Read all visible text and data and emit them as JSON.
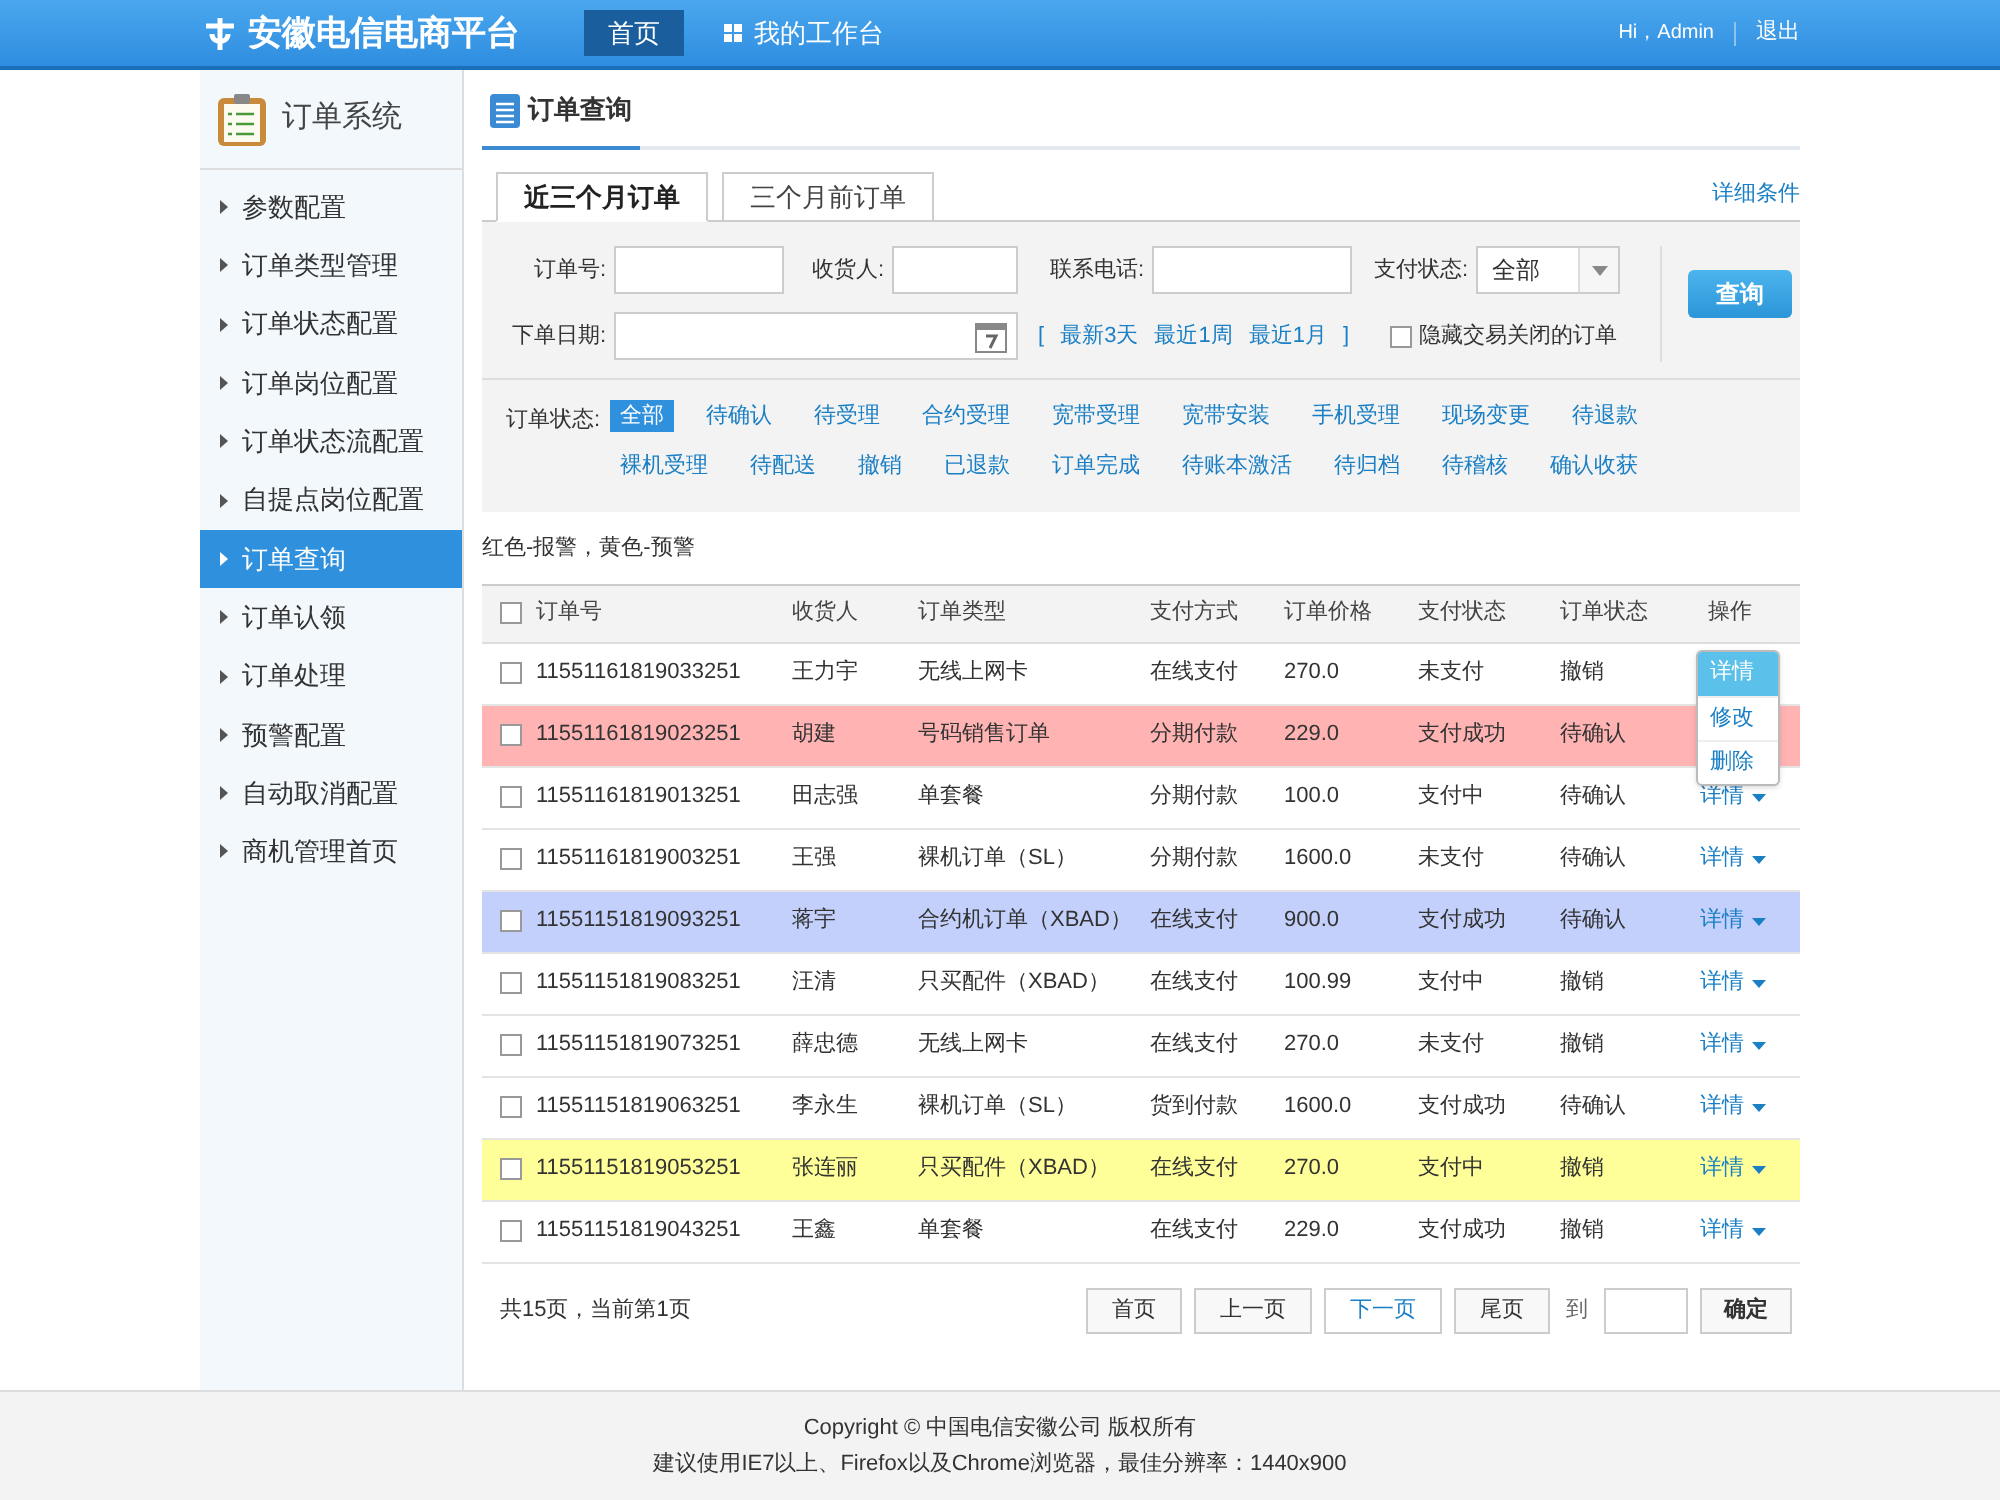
{
  "header": {
    "logo": "安徽电信电商平台",
    "nav": [
      {
        "label": "首页",
        "selected": true
      },
      {
        "label": "我的工作台",
        "selected": false
      }
    ],
    "greeting": "Hi，Admin",
    "logout": "退出"
  },
  "sidebar": {
    "title": "订单系统",
    "items": [
      {
        "label": "参数配置",
        "selected": false
      },
      {
        "label": "订单类型管理",
        "selected": false
      },
      {
        "label": "订单状态配置",
        "selected": false
      },
      {
        "label": "订单岗位配置",
        "selected": false
      },
      {
        "label": "订单状态流配置",
        "selected": false
      },
      {
        "label": "自提点岗位配置",
        "selected": false
      },
      {
        "label": "订单查询",
        "selected": true
      },
      {
        "label": "订单认领",
        "selected": false
      },
      {
        "label": "订单处理",
        "selected": false
      },
      {
        "label": "预警配置",
        "selected": false
      },
      {
        "label": "自动取消配置",
        "selected": false
      },
      {
        "label": "商机管理首页",
        "selected": false
      }
    ]
  },
  "page_title": "订单查询",
  "tabs": [
    {
      "label": "近三个月订单",
      "selected": true
    },
    {
      "label": "三个月前订单",
      "selected": false
    }
  ],
  "detail_link": "详细条件",
  "filters": {
    "order_no": {
      "label": "订单号:"
    },
    "receiver": {
      "label": "收货人:"
    },
    "phone": {
      "label": "联系电话:"
    },
    "pay_status": {
      "label": "支付状态:",
      "value": "全部"
    },
    "date": {
      "label": "下单日期:"
    },
    "quick_open": "[",
    "quick": [
      "最新3天",
      "最近1周",
      "最近1月"
    ],
    "quick_close": "]",
    "hide_closed": {
      "label": "隐藏交易关闭的订单",
      "checked": false
    },
    "search_button": "查询"
  },
  "status_filter": {
    "label": "订单状态:",
    "items": [
      {
        "label": "全部",
        "selected": true
      },
      {
        "label": "待确认",
        "selected": false
      },
      {
        "label": "待受理",
        "selected": false
      },
      {
        "label": "合约受理",
        "selected": false
      },
      {
        "label": "宽带受理",
        "selected": false
      },
      {
        "label": "宽带安装",
        "selected": false
      },
      {
        "label": "手机受理",
        "selected": false
      },
      {
        "label": "现场变更",
        "selected": false
      },
      {
        "label": "待退款",
        "selected": false
      },
      {
        "label": "裸机受理",
        "selected": false
      },
      {
        "label": "待配送",
        "selected": false
      },
      {
        "label": "撤销",
        "selected": false
      },
      {
        "label": "已退款",
        "selected": false
      },
      {
        "label": "订单完成",
        "selected": false
      },
      {
        "label": "待账本激活",
        "selected": false
      },
      {
        "label": "待归档",
        "selected": false
      },
      {
        "label": "待稽核",
        "selected": false
      },
      {
        "label": "确认收获",
        "selected": false
      }
    ]
  },
  "legend": "红色-报警，黄色-预警",
  "table": {
    "select_all": false,
    "columns": [
      "订单号",
      "收货人",
      "订单类型",
      "支付方式",
      "订单价格",
      "支付状态",
      "订单状态",
      "操作"
    ],
    "rows": [
      {
        "checked": false,
        "color": "#ffffff",
        "cells": [
          "11551161819033251",
          "王力宇",
          "无线上网卡",
          "在线支付",
          "270.0",
          "未支付",
          "撤销"
        ],
        "menu": [
          {
            "label": "详情",
            "selected": true
          },
          {
            "label": "修改",
            "selected": false
          },
          {
            "label": "删除",
            "selected": false
          }
        ]
      },
      {
        "checked": false,
        "color": "#ffb3b3",
        "cells": [
          "11551161819023251",
          "胡建",
          "号码销售订单",
          "分期付款",
          "229.0",
          "支付成功",
          "待确认"
        ]
      },
      {
        "checked": false,
        "color": "#ffffff",
        "cells": [
          "11551161819013251",
          "田志强",
          "单套餐",
          "分期付款",
          "100.0",
          "支付中",
          "待确认"
        ],
        "action": "详情"
      },
      {
        "checked": false,
        "color": "#ffffff",
        "cells": [
          "11551161819003251",
          "王强",
          "裸机订单（SL）",
          "分期付款",
          "1600.0",
          "未支付",
          "待确认"
        ],
        "action": "详情"
      },
      {
        "checked": false,
        "color": "#c4d0fc",
        "cells": [
          "11551151819093251",
          "蒋宇",
          "合约机订单（XBAD）",
          "在线支付",
          "900.0",
          "支付成功",
          "待确认"
        ],
        "action": "详情"
      },
      {
        "checked": false,
        "color": "#ffffff",
        "cells": [
          "11551151819083251",
          "汪清",
          "只买配件（XBAD）",
          "在线支付",
          "100.99",
          "支付中",
          "撤销"
        ],
        "action": "详情"
      },
      {
        "checked": false,
        "color": "#ffffff",
        "cells": [
          "11551151819073251",
          "薛忠德",
          "无线上网卡",
          "在线支付",
          "270.0",
          "未支付",
          "撤销"
        ],
        "action": "详情"
      },
      {
        "checked": false,
        "color": "#ffffff",
        "cells": [
          "11551151819063251",
          "李永生",
          "裸机订单（SL）",
          "货到付款",
          "1600.0",
          "支付成功",
          "待确认"
        ],
        "action": "详情"
      },
      {
        "checked": false,
        "color": "#ffff99",
        "cells": [
          "11551151819053251",
          "张连丽",
          "只买配件（XBAD）",
          "在线支付",
          "270.0",
          "支付中",
          "撤销"
        ],
        "action": "详情"
      },
      {
        "checked": false,
        "color": "#ffffff",
        "cells": [
          "11551151819043251",
          "王鑫",
          "单套餐",
          "在线支付",
          "229.0",
          "支付成功",
          "撤销"
        ],
        "action": "详情"
      }
    ]
  },
  "pagination": {
    "summary": "共15页，当前第1页",
    "buttons": [
      {
        "label": "首页",
        "highlighted": false
      },
      {
        "label": "上一页",
        "highlighted": false
      },
      {
        "label": "下一页",
        "highlighted": true
      },
      {
        "label": "尾页",
        "highlighted": false
      }
    ],
    "goto_label": "到",
    "confirm": "确定"
  },
  "footer": {
    "copyright": "Copyright © 中国电信安徽公司 版权所有",
    "note": "建议使用IE7以上、Firefox以及Chrome浏览器，最佳分辨率：1440x900"
  }
}
